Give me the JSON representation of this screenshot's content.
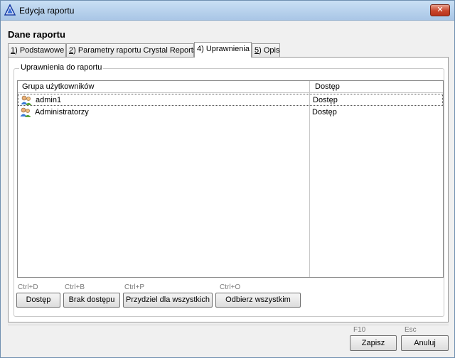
{
  "window": {
    "title": "Edycja raportu",
    "close_label": "✕"
  },
  "header": {
    "section_title": "Dane raportu"
  },
  "tabs": [
    {
      "mnemonic": "1",
      "label": ") Podstawowe"
    },
    {
      "mnemonic": "2",
      "label": ") Parametry raportu Crystal Reports"
    },
    {
      "mnemonic": "",
      "label": "4) Uprawnienia"
    },
    {
      "mnemonic": "5",
      "label": ") Opis"
    }
  ],
  "permissions": {
    "group_title": "Uprawnienia do raportu",
    "columns": [
      "Grupa użytkowników",
      "Dostęp"
    ],
    "rows": [
      {
        "group": "admin1",
        "access": "Dostęp",
        "icon": "user-group-icon"
      },
      {
        "group": "Administratorzy",
        "access": "Dostęp",
        "icon": "user-group-icon"
      }
    ]
  },
  "actions": {
    "grant": {
      "hint": "Ctrl+D",
      "label": "Dostęp"
    },
    "deny": {
      "hint": "Ctrl+B",
      "label": "Brak dostępu"
    },
    "grant_all": {
      "hint": "Ctrl+P",
      "label": "Przydziel dla wszystkich"
    },
    "revoke_all": {
      "hint": "Ctrl+O",
      "label": "Odbierz wszystkim"
    }
  },
  "footer": {
    "save": {
      "hint": "F10",
      "label": "Zapisz"
    },
    "cancel": {
      "hint": "Esc",
      "label": "Anuluj"
    }
  },
  "colors": {
    "titlebar": "#b6d0ec",
    "close_button": "#c8452b",
    "selected_row_border": "#555555"
  }
}
